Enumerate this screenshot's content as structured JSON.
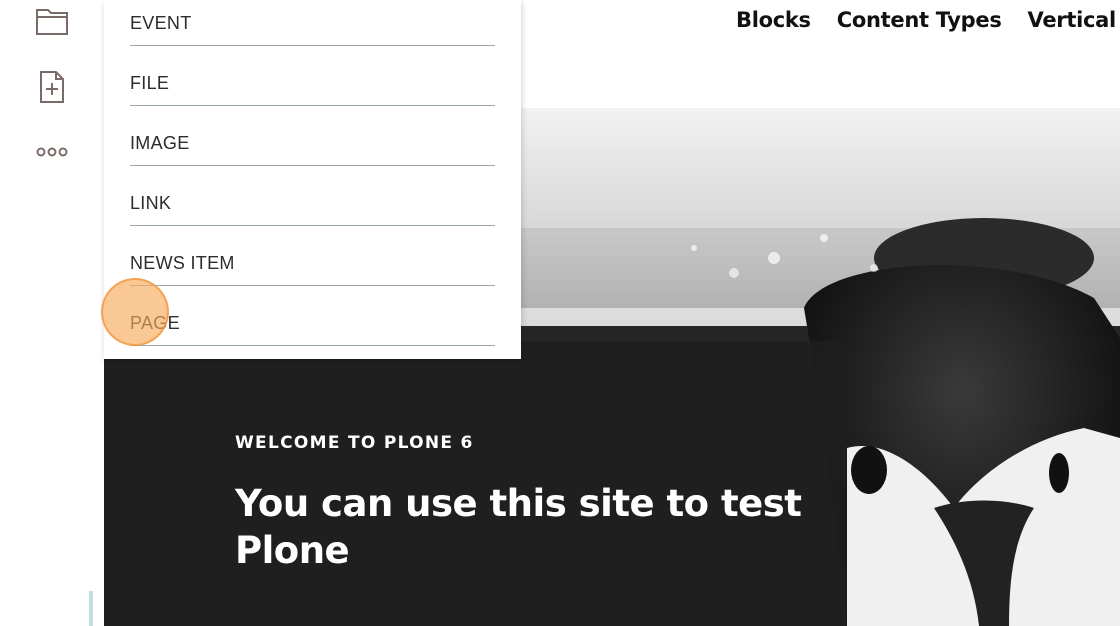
{
  "toolbar": {
    "icons": [
      "folder-icon",
      "add-document-icon",
      "more-icon"
    ]
  },
  "nav": {
    "items": [
      "Blocks",
      "Content Types",
      "Vertical S"
    ]
  },
  "dropdown": {
    "items": [
      "EVENT",
      "FILE",
      "IMAGE",
      "LINK",
      "NEWS ITEM",
      "PAGE"
    ]
  },
  "hero": {
    "eyebrow": "WELCOME TO PLONE 6",
    "title": "You can use this site to test Plone"
  },
  "colors": {
    "accent_marker": "#f6aa5a",
    "toolbar_icon": "#7a6a68",
    "divider": "#9aa8ad"
  }
}
